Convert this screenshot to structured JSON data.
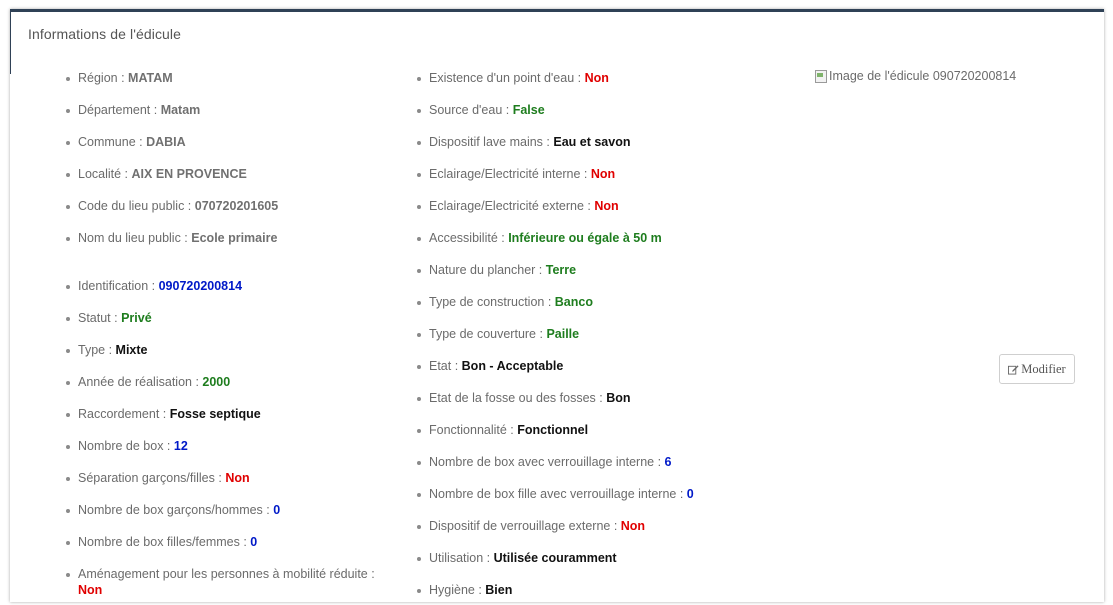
{
  "panel": {
    "title": "Informations de l'édicule"
  },
  "left_items": [
    {
      "label": "Région : ",
      "value": "MATAM",
      "color": "gray"
    },
    {
      "label": "Département : ",
      "value": "Matam",
      "color": "gray"
    },
    {
      "label": "Commune : ",
      "value": "DABIA",
      "color": "gray"
    },
    {
      "label": "Localité : ",
      "value": "AIX EN PROVENCE",
      "color": "gray"
    },
    {
      "label": "Code du lieu public : ",
      "value": "070720201605",
      "color": "gray"
    },
    {
      "label": "Nom du lieu public : ",
      "value": "Ecole primaire",
      "color": "gray"
    },
    {
      "label": "Identification : ",
      "value": "090720200814",
      "color": "blue"
    },
    {
      "label": "Statut : ",
      "value": "Privé",
      "color": "green"
    },
    {
      "label": "Type : ",
      "value": "Mixte",
      "color": "black"
    },
    {
      "label": "Année de réalisation : ",
      "value": "2000",
      "color": "green"
    },
    {
      "label": "Raccordement : ",
      "value": "Fosse septique",
      "color": "black"
    },
    {
      "label": "Nombre de box : ",
      "value": "12",
      "color": "blue"
    },
    {
      "label": "Séparation garçons/filles : ",
      "value": "Non",
      "color": "red"
    },
    {
      "label": "Nombre de box garçons/hommes : ",
      "value": "0",
      "color": "blue"
    },
    {
      "label": "Nombre de box filles/femmes : ",
      "value": "0",
      "color": "blue"
    },
    {
      "label": "Aménagement pour les personnes à mobilité réduite : ",
      "value": "Non",
      "color": "red"
    }
  ],
  "right_items": [
    {
      "label": "Existence d'un point d'eau : ",
      "value": "Non",
      "color": "red"
    },
    {
      "label": "Source d'eau : ",
      "value": "False",
      "color": "green"
    },
    {
      "label": "Dispositif lave mains : ",
      "value": "Eau et savon",
      "color": "black"
    },
    {
      "label": "Eclairage/Electricité interne : ",
      "value": "Non",
      "color": "red"
    },
    {
      "label": "Eclairage/Electricité externe : ",
      "value": "Non",
      "color": "red"
    },
    {
      "label": "Accessibilité : ",
      "value": "Inférieure ou égale à 50 m",
      "color": "green"
    },
    {
      "label": "Nature du plancher : ",
      "value": "Terre",
      "color": "green"
    },
    {
      "label": "Type de construction : ",
      "value": "Banco",
      "color": "green"
    },
    {
      "label": "Type de couverture : ",
      "value": "Paille",
      "color": "green"
    },
    {
      "label": "Etat : ",
      "value": "Bon - Acceptable",
      "color": "black"
    },
    {
      "label": "Etat de la fosse ou des fosses : ",
      "value": "Bon",
      "color": "black"
    },
    {
      "label": "Fonctionnalité : ",
      "value": "Fonctionnel",
      "color": "black"
    },
    {
      "label": "Nombre de box avec verrouillage interne : ",
      "value": "6",
      "color": "blue"
    },
    {
      "label": "Nombre de box fille avec verrouillage interne : ",
      "value": "0",
      "color": "blue"
    },
    {
      "label": "Dispositif de verrouillage externe : ",
      "value": "Non",
      "color": "red"
    },
    {
      "label": "Utilisation : ",
      "value": "Utilisée couramment",
      "color": "black"
    },
    {
      "label": "Hygiène : ",
      "value": "Bien",
      "color": "black"
    }
  ],
  "image": {
    "alt_text": "Image de l'édicule 090720200814",
    "icon": "broken-image-icon"
  },
  "actions": {
    "modify_label": "Modifier",
    "modify_icon": "edit-icon"
  }
}
